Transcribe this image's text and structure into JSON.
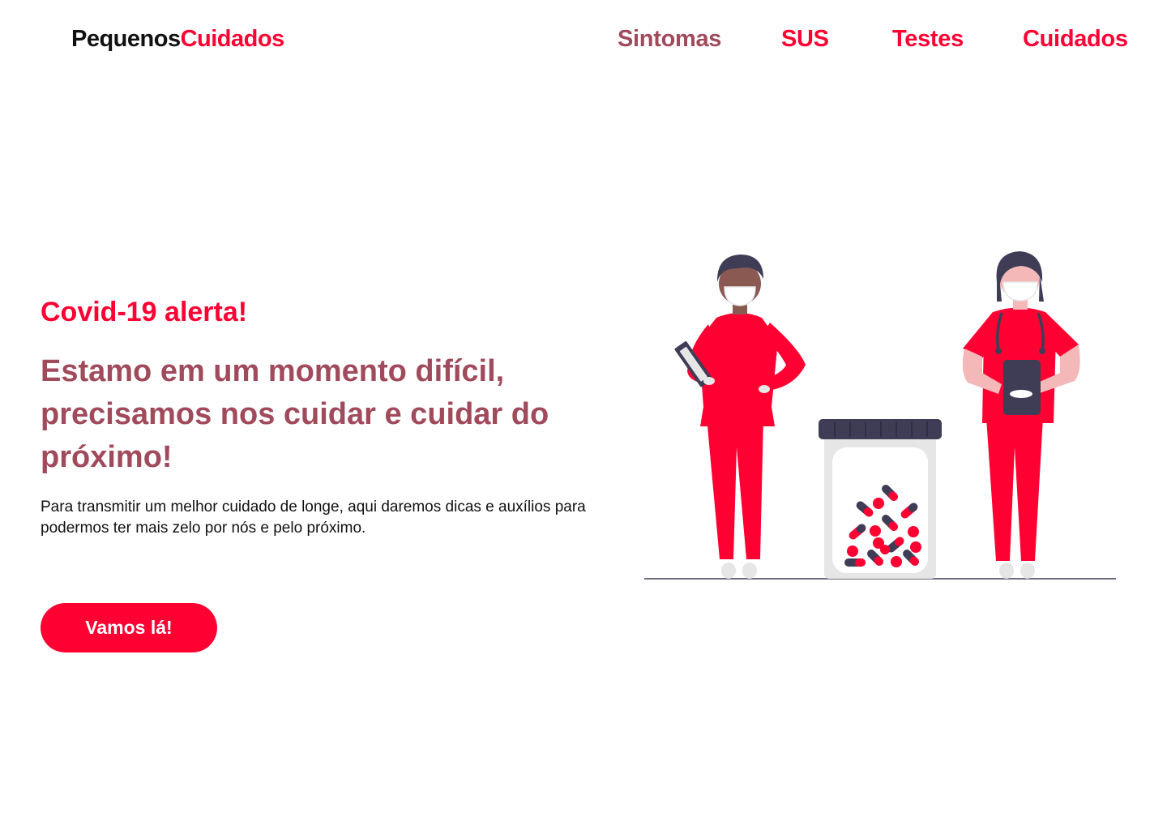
{
  "header": {
    "logo_part1": "Pequenos",
    "logo_part2": "Cuidados",
    "nav": [
      {
        "label": "Sintomas",
        "active": true
      },
      {
        "label": "SUS",
        "active": false
      },
      {
        "label": "Testes",
        "active": false
      },
      {
        "label": "Cuidados",
        "active": false
      }
    ]
  },
  "hero": {
    "alert": "Covid-19 alerta!",
    "headline": "Estamo em um momento difícil, precisamos nos cuidar e cuidar do próximo!",
    "description": "Para transmitir um melhor cuidado de longe, aqui daremos dicas e auxílios para podermos ter mais zelo por nós e pelo próximo.",
    "cta_label": "Vamos lá!"
  },
  "illustration": {
    "name": "medical-workers-illustration",
    "colors": {
      "accent": "#ff0033",
      "dark": "#3f3d56",
      "skin_dark": "#8a5a52",
      "skin_light": "#f5b8b8",
      "light_grey": "#e6e6e6"
    }
  }
}
